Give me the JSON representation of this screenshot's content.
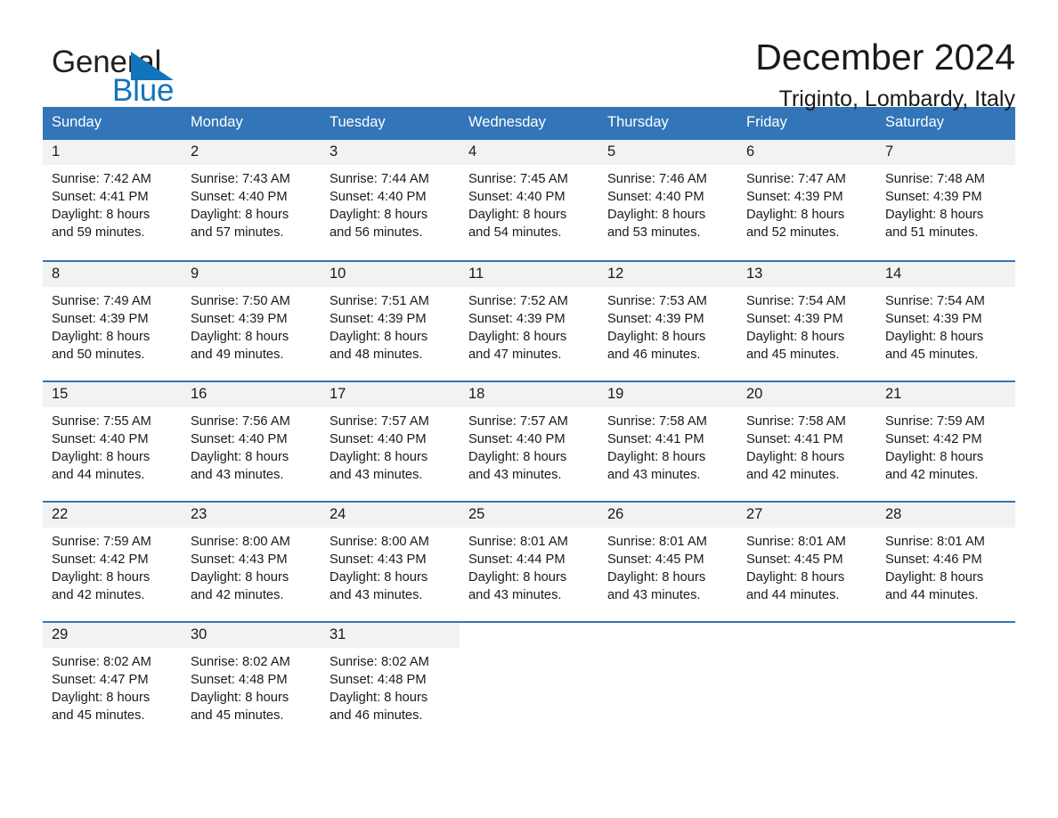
{
  "logo": {
    "word1": "General",
    "word2": "Blue",
    "triangle_color": "#1275bc",
    "icon": "triangle-icon"
  },
  "header": {
    "title": "December 2024",
    "subtitle": "Triginto, Lombardy, Italy"
  },
  "theme": {
    "header_blue": "#3275b8",
    "daynum_gray": "#f2f2f2",
    "text": "#1a1a1a"
  },
  "weekdays": [
    "Sunday",
    "Monday",
    "Tuesday",
    "Wednesday",
    "Thursday",
    "Friday",
    "Saturday"
  ],
  "weeks": [
    [
      {
        "day": "1",
        "sunrise": "Sunrise: 7:42 AM",
        "sunset": "Sunset: 4:41 PM",
        "daylight1": "Daylight: 8 hours",
        "daylight2": "and 59 minutes."
      },
      {
        "day": "2",
        "sunrise": "Sunrise: 7:43 AM",
        "sunset": "Sunset: 4:40 PM",
        "daylight1": "Daylight: 8 hours",
        "daylight2": "and 57 minutes."
      },
      {
        "day": "3",
        "sunrise": "Sunrise: 7:44 AM",
        "sunset": "Sunset: 4:40 PM",
        "daylight1": "Daylight: 8 hours",
        "daylight2": "and 56 minutes."
      },
      {
        "day": "4",
        "sunrise": "Sunrise: 7:45 AM",
        "sunset": "Sunset: 4:40 PM",
        "daylight1": "Daylight: 8 hours",
        "daylight2": "and 54 minutes."
      },
      {
        "day": "5",
        "sunrise": "Sunrise: 7:46 AM",
        "sunset": "Sunset: 4:40 PM",
        "daylight1": "Daylight: 8 hours",
        "daylight2": "and 53 minutes."
      },
      {
        "day": "6",
        "sunrise": "Sunrise: 7:47 AM",
        "sunset": "Sunset: 4:39 PM",
        "daylight1": "Daylight: 8 hours",
        "daylight2": "and 52 minutes."
      },
      {
        "day": "7",
        "sunrise": "Sunrise: 7:48 AM",
        "sunset": "Sunset: 4:39 PM",
        "daylight1": "Daylight: 8 hours",
        "daylight2": "and 51 minutes."
      }
    ],
    [
      {
        "day": "8",
        "sunrise": "Sunrise: 7:49 AM",
        "sunset": "Sunset: 4:39 PM",
        "daylight1": "Daylight: 8 hours",
        "daylight2": "and 50 minutes."
      },
      {
        "day": "9",
        "sunrise": "Sunrise: 7:50 AM",
        "sunset": "Sunset: 4:39 PM",
        "daylight1": "Daylight: 8 hours",
        "daylight2": "and 49 minutes."
      },
      {
        "day": "10",
        "sunrise": "Sunrise: 7:51 AM",
        "sunset": "Sunset: 4:39 PM",
        "daylight1": "Daylight: 8 hours",
        "daylight2": "and 48 minutes."
      },
      {
        "day": "11",
        "sunrise": "Sunrise: 7:52 AM",
        "sunset": "Sunset: 4:39 PM",
        "daylight1": "Daylight: 8 hours",
        "daylight2": "and 47 minutes."
      },
      {
        "day": "12",
        "sunrise": "Sunrise: 7:53 AM",
        "sunset": "Sunset: 4:39 PM",
        "daylight1": "Daylight: 8 hours",
        "daylight2": "and 46 minutes."
      },
      {
        "day": "13",
        "sunrise": "Sunrise: 7:54 AM",
        "sunset": "Sunset: 4:39 PM",
        "daylight1": "Daylight: 8 hours",
        "daylight2": "and 45 minutes."
      },
      {
        "day": "14",
        "sunrise": "Sunrise: 7:54 AM",
        "sunset": "Sunset: 4:39 PM",
        "daylight1": "Daylight: 8 hours",
        "daylight2": "and 45 minutes."
      }
    ],
    [
      {
        "day": "15",
        "sunrise": "Sunrise: 7:55 AM",
        "sunset": "Sunset: 4:40 PM",
        "daylight1": "Daylight: 8 hours",
        "daylight2": "and 44 minutes."
      },
      {
        "day": "16",
        "sunrise": "Sunrise: 7:56 AM",
        "sunset": "Sunset: 4:40 PM",
        "daylight1": "Daylight: 8 hours",
        "daylight2": "and 43 minutes."
      },
      {
        "day": "17",
        "sunrise": "Sunrise: 7:57 AM",
        "sunset": "Sunset: 4:40 PM",
        "daylight1": "Daylight: 8 hours",
        "daylight2": "and 43 minutes."
      },
      {
        "day": "18",
        "sunrise": "Sunrise: 7:57 AM",
        "sunset": "Sunset: 4:40 PM",
        "daylight1": "Daylight: 8 hours",
        "daylight2": "and 43 minutes."
      },
      {
        "day": "19",
        "sunrise": "Sunrise: 7:58 AM",
        "sunset": "Sunset: 4:41 PM",
        "daylight1": "Daylight: 8 hours",
        "daylight2": "and 43 minutes."
      },
      {
        "day": "20",
        "sunrise": "Sunrise: 7:58 AM",
        "sunset": "Sunset: 4:41 PM",
        "daylight1": "Daylight: 8 hours",
        "daylight2": "and 42 minutes."
      },
      {
        "day": "21",
        "sunrise": "Sunrise: 7:59 AM",
        "sunset": "Sunset: 4:42 PM",
        "daylight1": "Daylight: 8 hours",
        "daylight2": "and 42 minutes."
      }
    ],
    [
      {
        "day": "22",
        "sunrise": "Sunrise: 7:59 AM",
        "sunset": "Sunset: 4:42 PM",
        "daylight1": "Daylight: 8 hours",
        "daylight2": "and 42 minutes."
      },
      {
        "day": "23",
        "sunrise": "Sunrise: 8:00 AM",
        "sunset": "Sunset: 4:43 PM",
        "daylight1": "Daylight: 8 hours",
        "daylight2": "and 42 minutes."
      },
      {
        "day": "24",
        "sunrise": "Sunrise: 8:00 AM",
        "sunset": "Sunset: 4:43 PM",
        "daylight1": "Daylight: 8 hours",
        "daylight2": "and 43 minutes."
      },
      {
        "day": "25",
        "sunrise": "Sunrise: 8:01 AM",
        "sunset": "Sunset: 4:44 PM",
        "daylight1": "Daylight: 8 hours",
        "daylight2": "and 43 minutes."
      },
      {
        "day": "26",
        "sunrise": "Sunrise: 8:01 AM",
        "sunset": "Sunset: 4:45 PM",
        "daylight1": "Daylight: 8 hours",
        "daylight2": "and 43 minutes."
      },
      {
        "day": "27",
        "sunrise": "Sunrise: 8:01 AM",
        "sunset": "Sunset: 4:45 PM",
        "daylight1": "Daylight: 8 hours",
        "daylight2": "and 44 minutes."
      },
      {
        "day": "28",
        "sunrise": "Sunrise: 8:01 AM",
        "sunset": "Sunset: 4:46 PM",
        "daylight1": "Daylight: 8 hours",
        "daylight2": "and 44 minutes."
      }
    ],
    [
      {
        "day": "29",
        "sunrise": "Sunrise: 8:02 AM",
        "sunset": "Sunset: 4:47 PM",
        "daylight1": "Daylight: 8 hours",
        "daylight2": "and 45 minutes."
      },
      {
        "day": "30",
        "sunrise": "Sunrise: 8:02 AM",
        "sunset": "Sunset: 4:48 PM",
        "daylight1": "Daylight: 8 hours",
        "daylight2": "and 45 minutes."
      },
      {
        "day": "31",
        "sunrise": "Sunrise: 8:02 AM",
        "sunset": "Sunset: 4:48 PM",
        "daylight1": "Daylight: 8 hours",
        "daylight2": "and 46 minutes."
      },
      {
        "day": "",
        "sunrise": "",
        "sunset": "",
        "daylight1": "",
        "daylight2": "",
        "empty": true
      },
      {
        "day": "",
        "sunrise": "",
        "sunset": "",
        "daylight1": "",
        "daylight2": "",
        "empty": true
      },
      {
        "day": "",
        "sunrise": "",
        "sunset": "",
        "daylight1": "",
        "daylight2": "",
        "empty": true
      },
      {
        "day": "",
        "sunrise": "",
        "sunset": "",
        "daylight1": "",
        "daylight2": "",
        "empty": true
      }
    ]
  ]
}
